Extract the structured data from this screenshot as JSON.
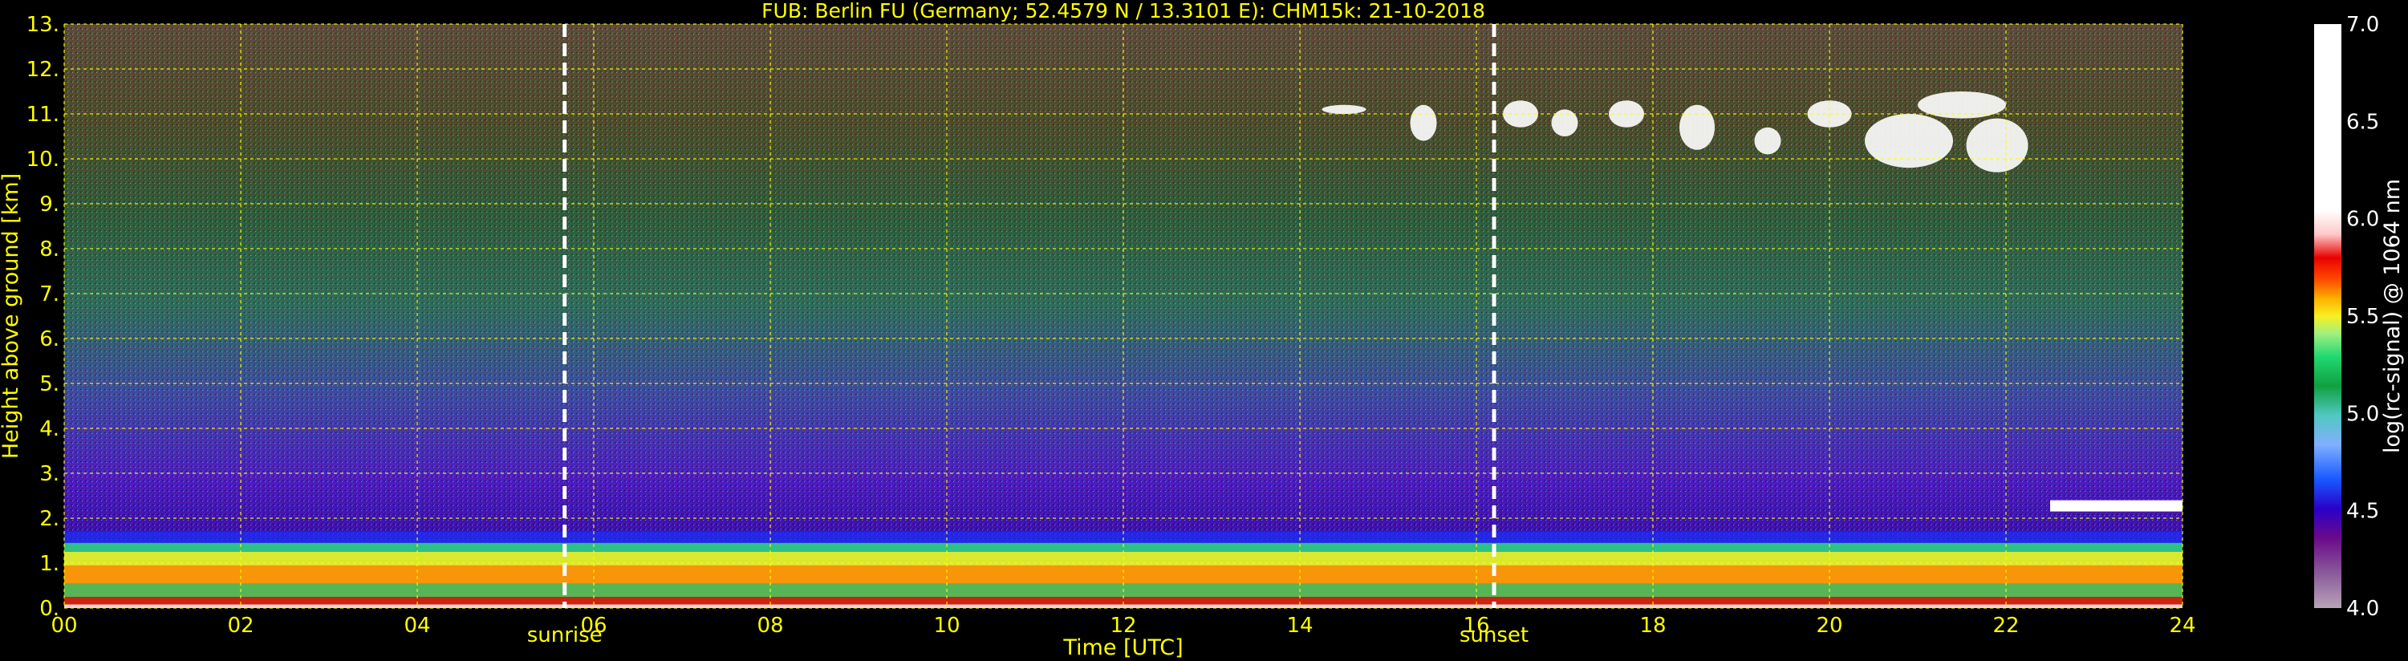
{
  "chart_data": {
    "type": "heatmap",
    "title": "FUB: Berlin FU (Germany; 52.4579 N / 13.3101 E):    CHM15k: 21-10-2018",
    "xlabel": "Time [UTC]",
    "ylabel": "Height above ground [km]",
    "xlim": [
      0,
      24
    ],
    "ylim": [
      0,
      13
    ],
    "x_ticks": [
      "00",
      "02",
      "04",
      "06",
      "08",
      "10",
      "12",
      "14",
      "16",
      "18",
      "20",
      "22",
      "24"
    ],
    "y_ticks": [
      "0.",
      "1.",
      "2.",
      "3.",
      "4.",
      "5.",
      "6.",
      "7.",
      "8.",
      "9.",
      "10.",
      "11.",
      "12.",
      "13."
    ],
    "grid": true,
    "events": [
      {
        "label": "sunrise",
        "x": 5.67
      },
      {
        "label": "sunset",
        "x": 16.2
      }
    ],
    "colorbar": {
      "label": "log(rc-signal) @ 1064 nm",
      "range": [
        4.0,
        7.0
      ],
      "ticks": [
        "4.0",
        "4.5",
        "5.0",
        "5.5",
        "6.0",
        "6.5",
        "7.0"
      ]
    },
    "features": [
      {
        "name": "boundary layer aerosol",
        "x_range": [
          0,
          24
        ],
        "height_km": [
          0,
          1.7
        ],
        "level": 5.6
      },
      {
        "name": "high cirrus clouds",
        "x_range": [
          14.4,
          22.6
        ],
        "height_km": [
          9.6,
          11.5
        ],
        "level": 6.8
      },
      {
        "name": "low cloud",
        "x_range": [
          22.5,
          24
        ],
        "height_km": [
          2.15,
          2.4
        ],
        "level": 7.0
      }
    ]
  },
  "colors": {
    "background": "#000000",
    "text": "#ffff00",
    "grid": "#ffff00",
    "event_line": "#ffffff",
    "colormap": [
      "#b8a3b8",
      "#8a5a9a",
      "#6a0a8a",
      "#2a00c8",
      "#1858ff",
      "#80b0ff",
      "#50c8c0",
      "#10a040",
      "#20d870",
      "#a0f080",
      "#f8f020",
      "#ffb000",
      "#ff5000",
      "#e80000",
      "#ffc8c8",
      "#ffffff"
    ]
  }
}
